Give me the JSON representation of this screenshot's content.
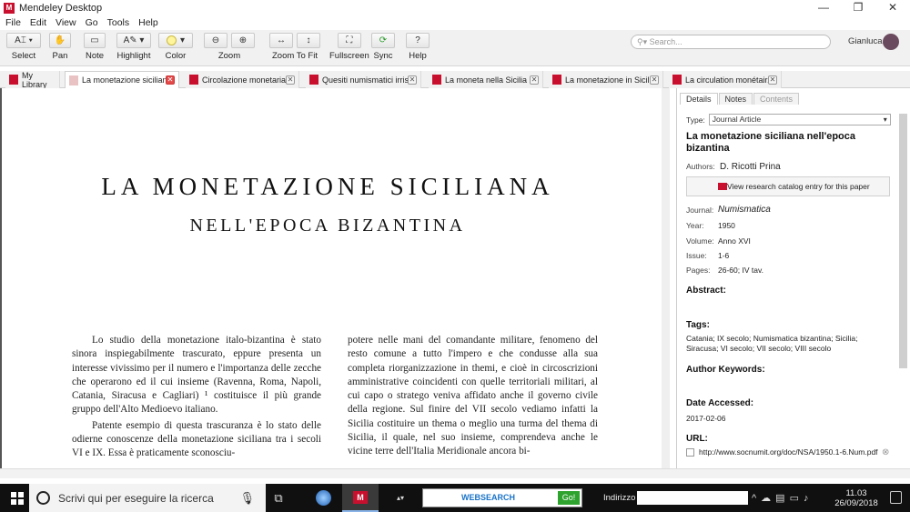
{
  "window": {
    "title": "Mendeley Desktop",
    "controls": [
      "—",
      "❐",
      "✕"
    ]
  },
  "menu": [
    "File",
    "Edit",
    "View",
    "Go",
    "Tools",
    "Help"
  ],
  "toolbar": {
    "select": "Select",
    "pan": "Pan",
    "note": "Note",
    "highlight": "Highlight",
    "color": "Color",
    "zoom": "Zoom",
    "zoom_to_fit": "Zoom To Fit",
    "fullscreen": "Fullscreen",
    "sync": "Sync",
    "help": "Help"
  },
  "search": {
    "placeholder": "Search..."
  },
  "user": {
    "name": "Gianluca"
  },
  "tabs": [
    {
      "label": "My Library"
    },
    {
      "label": "La monetazione sicilian..."
    },
    {
      "label": "Circolazione monetaria..."
    },
    {
      "label": "Quesiti numismatici irris..."
    },
    {
      "label": "La moneta nella Sicilia ..."
    },
    {
      "label": "La monetazione in Sicil..."
    },
    {
      "label": "La circulation monétair..."
    }
  ],
  "document": {
    "title": "LA MONETAZIONE SICILIANA",
    "subtitle": "NELL'EPOCA BIZANTINA",
    "col1_p1": "Lo studio della monetazione italo-bizantina è stato sinora inspiegabilmente trascurato, eppure presenta un interesse vivissimo per il numero e l'importanza delle zecche che operarono ed il cui insieme (Ravenna, Roma, Napoli, Catania, Siracusa e Cagliari) ¹ costituisce il più grande gruppo dell'Alto Medioevo italiano.",
    "col1_p2": "Patente esempio di questa trascuranza è lo stato delle odierne conoscenze della monetazione siciliana tra i secoli VI e IX. Essa è praticamente sconosciu-",
    "col2_p1": "potere nelle mani del comandante militare, fenomeno del resto comune a tutto l'impero e che condusse alla sua completa riorganizzazione in themi, e cioè in circoscrizioni amministrative coincidenti con quelle territoriali militari, al cui capo o stratego veniva affidato anche il governo civile della regione. Sul finire del VII secolo vediamo infatti la Sicilia costituire un thema o meglio una turma del thema di Sicilia, il quale, nel suo insieme, comprendeva anche le vicine terre dell'Italia Meridionale ancora bi-"
  },
  "panel": {
    "tabs": [
      "Details",
      "Notes",
      "Contents"
    ],
    "type_label": "Type:",
    "type_value": "Journal Article",
    "title": "La monetazione siciliana nell'epoca bizantina",
    "authors_label": "Authors:",
    "authors_value": "D. Ricotti Prina",
    "catalog_button": "View research catalog entry for this paper",
    "journal_label": "Journal:",
    "journal_value": "Numismatica",
    "year_label": "Year:",
    "year_value": "1950",
    "volume_label": "Volume:",
    "volume_value": "Anno XVI",
    "issue_label": "Issue:",
    "issue_value": "1-6",
    "pages_label": "Pages:",
    "pages_value": "26-60; IV tav.",
    "abstract_label": "Abstract:",
    "tags_label": "Tags:",
    "tags_value": "Catania; IX secolo; Numismatica bizantina; Sicilia; Siracusa; VI secolo; VII secolo; VIII secolo",
    "keywords_label": "Author Keywords:",
    "date_label": "Date Accessed:",
    "date_value": "2017-02-06",
    "url_label": "URL:",
    "url_value": "http://www.socnumit.org/doc/NSA/1950.1-6.Num.pdf"
  },
  "taskbar": {
    "search_placeholder": "Scrivi qui per eseguire la ricerca",
    "websearch_logo": "WEBSEARCH",
    "websearch_go": "Go!",
    "address_label": "Indirizzo",
    "time": "11.03",
    "date": "26/09/2018"
  }
}
